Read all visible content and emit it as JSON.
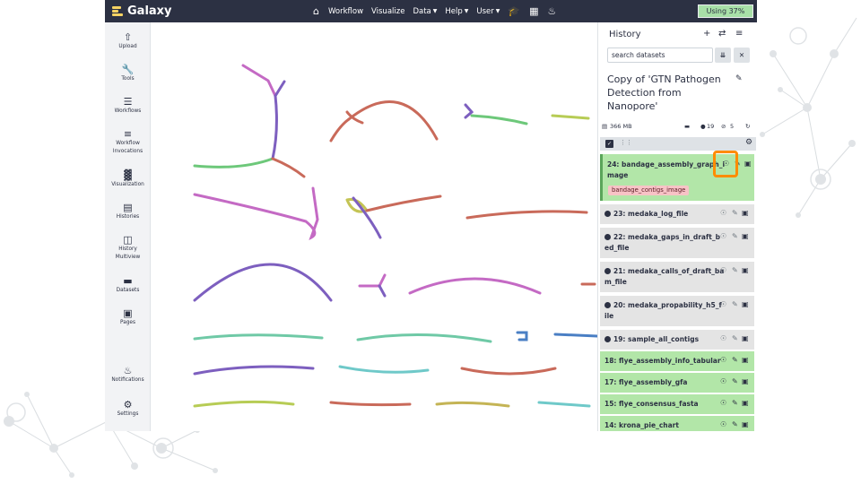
{
  "brand": "Galaxy",
  "nav": [
    "Workflow",
    "Visualize",
    "Data",
    "Help",
    "User"
  ],
  "usage": "Using 37%",
  "activity": [
    {
      "label1": "Upload",
      "label2": "",
      "icon": "upload-icon"
    },
    {
      "label1": "Tools",
      "label2": "",
      "icon": "wrench-icon"
    },
    {
      "label1": "Workflows",
      "label2": "",
      "icon": "sitemap-icon"
    },
    {
      "label1": "Workflow",
      "label2": "Invocations",
      "icon": "list-icon"
    },
    {
      "label1": "Visualization",
      "label2": "",
      "icon": "chart-bar-icon"
    },
    {
      "label1": "Histories",
      "label2": "",
      "icon": "hdd-icon"
    },
    {
      "label1": "History",
      "label2": "Multiview",
      "icon": "columns-icon"
    },
    {
      "label1": "Datasets",
      "label2": "",
      "icon": "folder-icon"
    },
    {
      "label1": "Pages",
      "label2": "",
      "icon": "file-icon"
    },
    {
      "label1": "Notifications",
      "label2": "",
      "icon": "bell-icon"
    },
    {
      "label1": "Settings",
      "label2": "",
      "icon": "cog-icon"
    }
  ],
  "history": {
    "title": "History",
    "search_placeholder": "search datasets",
    "name": "Copy of 'GTN Pathogen Detection from Nanopore'",
    "size": "366 MB",
    "count_visible": "19",
    "count_hidden": "5",
    "items": [
      {
        "line1": "24: bandage_assembly_graph_i",
        "line2": "mage",
        "state": "ok",
        "tag": "bandage_contigs_image"
      },
      {
        "line1": "23: medaka_log_file",
        "line2": "",
        "state": "err"
      },
      {
        "line1": "22: medaka_gaps_in_draft_b",
        "line2": "ed_file",
        "state": "err"
      },
      {
        "line1": "21: medaka_calls_of_draft_ba",
        "line2": "m_file",
        "state": "err"
      },
      {
        "line1": "20: medaka_propability_h5_f",
        "line2": "ile",
        "state": "err"
      },
      {
        "line1": "19: sample_all_contigs",
        "line2": "",
        "state": "err"
      },
      {
        "line1": "18: flye_assembly_info_tabular",
        "line2": "",
        "state": "ok"
      },
      {
        "line1": "17: flye_assembly_gfa",
        "line2": "",
        "state": "ok"
      },
      {
        "line1": "15: flye_consensus_fasta",
        "line2": "",
        "state": "ok"
      },
      {
        "line1": "14: krona_pie_chart",
        "line2": "",
        "state": "ok"
      }
    ]
  },
  "colors": {
    "nav": "#2c3143",
    "ok": "#b2e6a8",
    "err": "#e4e4e4",
    "highlight": "#ff8c00",
    "tag": "#f7c3c6",
    "usage": "#a8e0a8"
  }
}
